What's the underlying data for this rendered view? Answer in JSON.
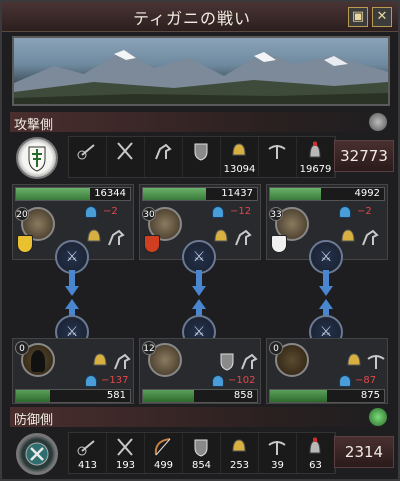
{
  "window": {
    "title": "ティガニの戦い"
  },
  "buttons": {
    "mini_icon": "▣",
    "close_icon": "✕"
  },
  "attacker": {
    "label": "攻撃側",
    "units": [
      {
        "icon": "catapult-icon",
        "count": ""
      },
      {
        "icon": "axe-icon",
        "count": ""
      },
      {
        "icon": "horse-icon",
        "count": ""
      },
      {
        "icon": "shield-icon",
        "count": ""
      },
      {
        "icon": "helmet-icon",
        "count": "13094"
      },
      {
        "icon": "crossbow-icon",
        "count": ""
      },
      {
        "icon": "knight-icon",
        "count": "19679"
      }
    ],
    "total": "32773",
    "columns": [
      {
        "strength": "16344",
        "fill": 0.65,
        "level": "20",
        "morale": "−2",
        "shield_color": "#e8c030"
      },
      {
        "strength": "11437",
        "fill": 0.55,
        "level": "30",
        "morale": "−12",
        "shield_color": "#d04020"
      },
      {
        "strength": "4992",
        "fill": 0.45,
        "level": "33",
        "morale": "−2",
        "shield_color": "#f0f0f0"
      }
    ]
  },
  "defender": {
    "label": "防御側",
    "units": [
      {
        "icon": "catapult-icon",
        "count": "413"
      },
      {
        "icon": "axe-icon",
        "count": "193"
      },
      {
        "icon": "bow-icon",
        "count": "499"
      },
      {
        "icon": "shield-icon",
        "count": "854"
      },
      {
        "icon": "helmet-icon",
        "count": "253"
      },
      {
        "icon": "crossbow-icon",
        "count": "39"
      },
      {
        "icon": "knight-icon",
        "count": "63"
      }
    ],
    "total": "2314",
    "columns": [
      {
        "strength": "581",
        "fill": 0.3,
        "level": "0",
        "morale": "−137"
      },
      {
        "strength": "858",
        "fill": 0.45,
        "level": "12",
        "morale": "−102"
      },
      {
        "strength": "875",
        "fill": 0.5,
        "level": "0",
        "morale": "−87"
      }
    ]
  },
  "colors": {
    "accent": "#4a86d0",
    "strength": "#4a9a4a",
    "morale": "#e04848"
  }
}
